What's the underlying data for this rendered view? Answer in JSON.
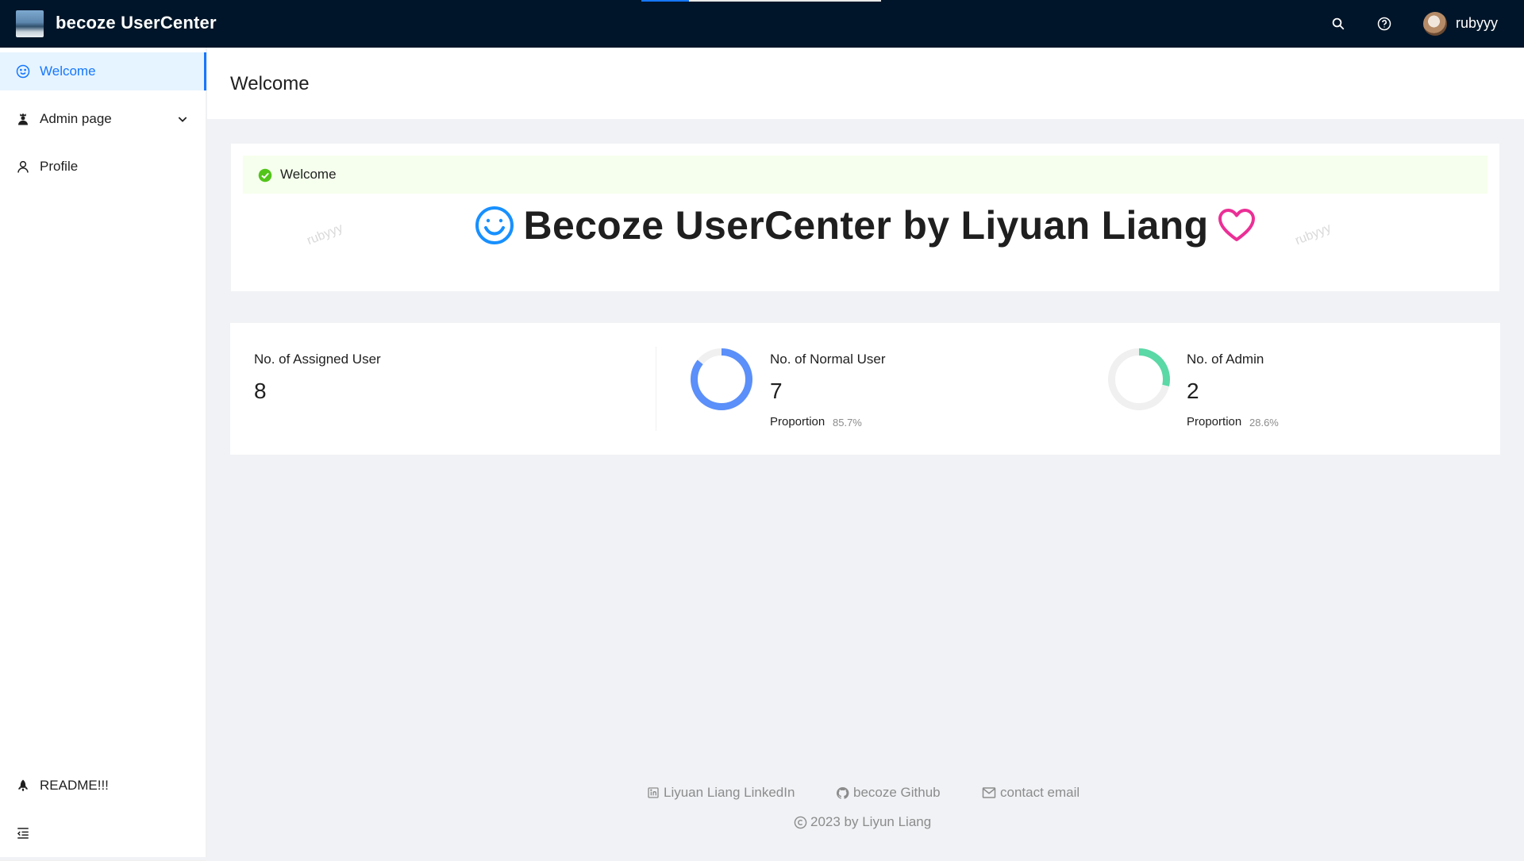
{
  "header": {
    "app_title": "becoze UserCenter",
    "username": "rubyyy",
    "icons": {
      "search": "search-icon",
      "help": "question-circle-icon",
      "avatar": "user-avatar"
    }
  },
  "sidebar": {
    "items": [
      {
        "label": "Welcome",
        "icon": "smile-icon",
        "selected": true
      },
      {
        "label": "Admin page",
        "icon": "crown-user-icon",
        "expandable": true
      },
      {
        "label": "Profile",
        "icon": "user-icon"
      }
    ],
    "bottom_item": {
      "label": "README!!!",
      "icon": "rocket-icon"
    },
    "collapse_icon": "menu-fold-icon"
  },
  "page": {
    "title": "Welcome"
  },
  "welcome_card": {
    "alert_text": "Welcome",
    "headline": "Becoze UserCenter by Liyuan Liang",
    "watermark": "rubyyy"
  },
  "stats": {
    "assigned": {
      "label": "No. of Assigned User",
      "value": "8"
    },
    "normal": {
      "label": "No. of Normal User",
      "value": "7",
      "proportion_label": "Proportion",
      "proportion_value": "85.7%",
      "fraction": 0.857,
      "color": "#5b8ff9"
    },
    "admin": {
      "label": "No. of Admin",
      "value": "2",
      "proportion_label": "Proportion",
      "proportion_value": "28.6%",
      "fraction": 0.286,
      "color": "#5ad8a6"
    }
  },
  "footer": {
    "links": [
      {
        "label": "Liyuan Liang LinkedIn",
        "icon": "linkedin-icon"
      },
      {
        "label": "becoze Github",
        "icon": "github-icon"
      },
      {
        "label": "contact email",
        "icon": "mail-icon"
      }
    ],
    "copyright": "2023 by Liyun Liang"
  },
  "colors": {
    "header_bg": "#001529",
    "accent": "#1677ff",
    "success": "#52c41a",
    "heart": "#eb2f96"
  }
}
